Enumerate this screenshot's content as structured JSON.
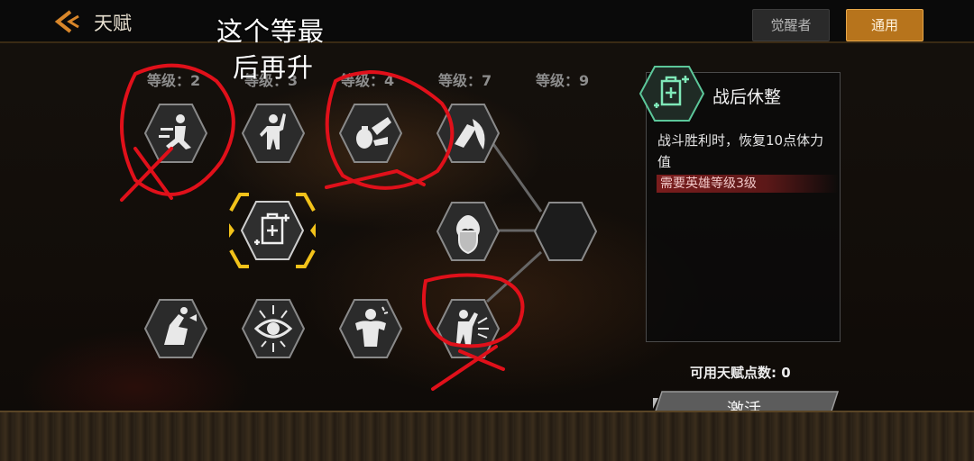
{
  "header": {
    "title": "天赋",
    "tabs": [
      {
        "label": "觉醒者"
      },
      {
        "label": "通用"
      }
    ],
    "active_tab": "通用"
  },
  "annotation": {
    "line1": "这个等最",
    "line2": "后再升",
    "mark_color": "#e0101a"
  },
  "levels": [
    "等级：2",
    "等级：3",
    "等级：4",
    "等级：7",
    "等级：9"
  ],
  "talents": [
    {
      "icon": "running-figure-icon"
    },
    {
      "icon": "brawler-figure-icon"
    },
    {
      "icon": "grenade-hand-icon"
    },
    {
      "icon": "shield-arm-icon"
    },
    {
      "icon": "medkit-icon",
      "selected": true
    },
    {
      "icon": "flame-shield-icon"
    },
    {
      "icon": "empty-slot-icon"
    },
    {
      "icon": "shout-figure-icon"
    },
    {
      "icon": "eye-icon"
    },
    {
      "icon": "flex-figure-icon"
    },
    {
      "icon": "dodge-figure-icon"
    }
  ],
  "detail": {
    "name": "战后休整",
    "icon": "medkit-icon",
    "description": "战斗胜利时，恢复10点体力值",
    "requirement": "需要英雄等级3级"
  },
  "available_points": "可用天赋点数: 0",
  "activate_label": "激活",
  "colors": {
    "accent": "#c8841f",
    "requirement_bg": "#7a1d1d"
  }
}
